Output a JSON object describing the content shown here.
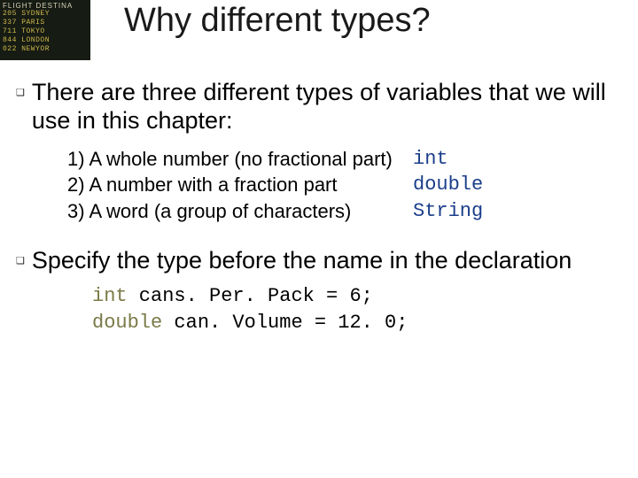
{
  "title": "Why different types?",
  "decorImage": {
    "heading": "FLIGHT   DESTINA",
    "rows": [
      "205  SYDNEY",
      "337  PARIS",
      "711  TOKYO",
      "844  LONDON",
      "022  NEWYOR"
    ]
  },
  "bullet1": "There are three different types of variables that we will use in this chapter:",
  "subitems": [
    {
      "desc": "1) A whole number (no fractional part)",
      "type": "int"
    },
    {
      "desc": "2) A number with a fraction part",
      "type": "double"
    },
    {
      "desc": "3) A word (a group of characters)",
      "type": "String"
    }
  ],
  "bullet2": "Specify the type before the name in the declaration",
  "code": {
    "line1_kw": "int",
    "line1_rest": " cans. Per. Pack = 6;",
    "line2_kw": " double",
    "line2_rest": " can. Volume = 12. 0;"
  }
}
